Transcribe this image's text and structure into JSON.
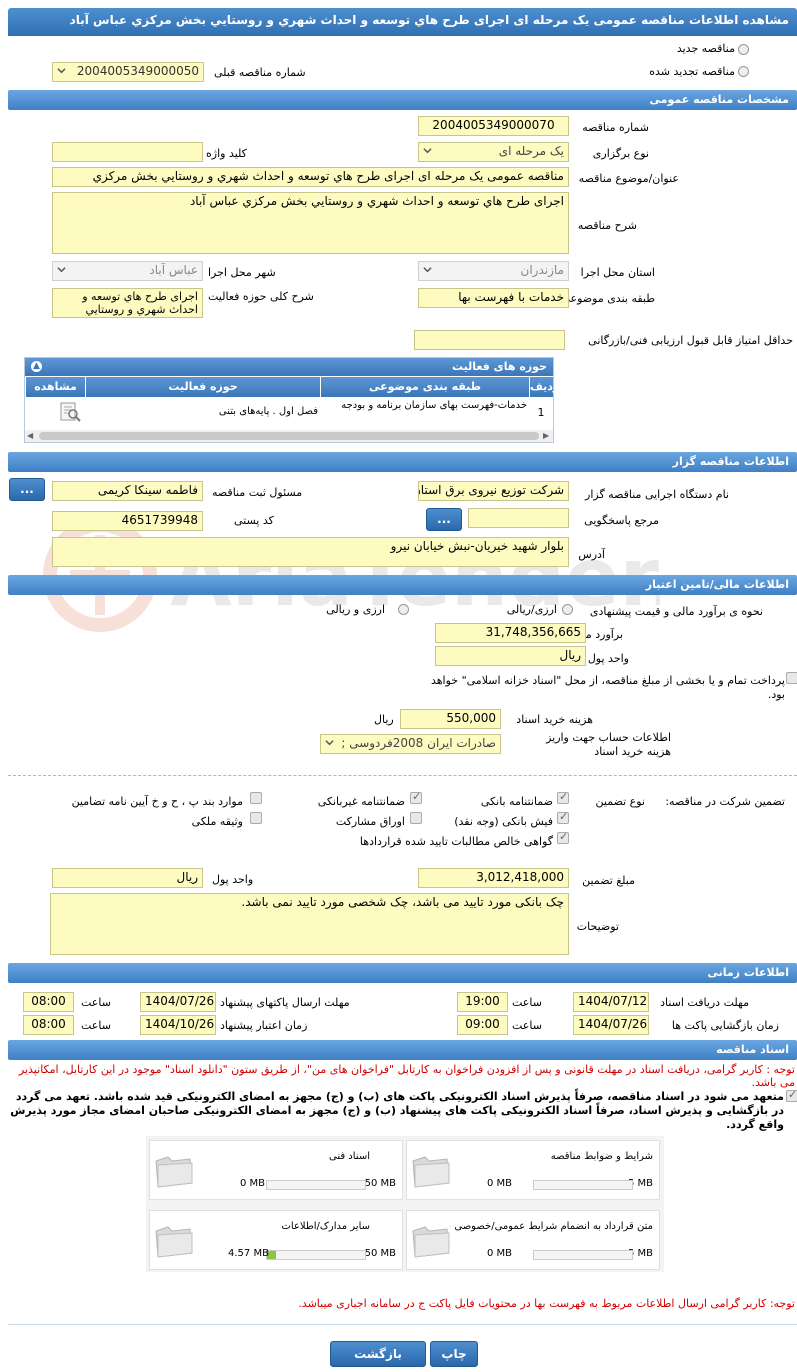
{
  "title": "مشاهده اطلاعات مناقصه عمومی یک مرحله ای اجرای طرح هاي توسعه و احداث شهري و روستايي بخش مرکزي عباس آباد",
  "top": {
    "radio_new": "مناقصه جدید",
    "radio_renewed": "مناقصه تجدید شده",
    "prev_number_label": "شماره مناقصه قبلی",
    "prev_number_value": "2004005349000050"
  },
  "sections": {
    "general": "مشخصات مناقصه عمومی",
    "organizer": "اطلاعات مناقصه گزار",
    "financial": "اطلاعات مالی/تامین اعتبار",
    "timing": "اطلاعات زمانی",
    "documents": "اسناد مناقصه"
  },
  "general": {
    "number_label": "شماره مناقصه",
    "number_value": "2004005349000070",
    "type_label": "نوع برگزاری",
    "type_value": "یک مرحله ای",
    "keyword_label": "کلید واژه",
    "keyword_value": "",
    "subject_label": "عنوان/موضوع مناقصه",
    "subject_value": "مناقصه عمومی یک مرحله ای اجرای طرح هاي توسعه و احداث شهري و روستايي بخش مرکزي",
    "desc_label": "شرح مناقصه",
    "desc_value": "اجرای طرح هاي توسعه و احداث شهري و روستايي بخش مرکزي عباس آباد",
    "province_label": "استان محل اجرا",
    "province_value": "مازندران",
    "city_label": "شهر محل اجرا",
    "city_value": "عباس آباد",
    "category_label": "طبقه بندی موضوعی",
    "category_value": "خدمات با فهرست بها",
    "activity_label": "شرح کلی حوزه فعالیت",
    "activity_value": "اجرای طرح هاي توسعه و احداث شهري و روستايي",
    "min_score_label": "حداقل امتیاز قابل قبول ارزیابی فنی/بازرگانی",
    "min_score_value": ""
  },
  "activity_grid": {
    "title": "حوزه های فعالیت",
    "columns": [
      "ردیف",
      "طبقه بندی موضوعی",
      "حوزه فعالیت",
      "مشاهده"
    ],
    "rows": [
      {
        "index": "1",
        "category": "خدمات-فهرست بهای سازمان برنامه و بودجه",
        "field": "فصل اول . پایه‌های بتنی"
      }
    ]
  },
  "organizer": {
    "device_label": "نام دستگاه اجرایی مناقصه گزار",
    "device_value": "شرکت توزیع نیروی برق استان",
    "registrar_label": "مسئول ثبت مناقصه",
    "registrar_value": "فاطمه  سینکا کریمی",
    "more_button": "...",
    "reference_label": "مرجع پاسخگویی",
    "reference_value": "",
    "postal_label": "کد پستی",
    "postal_value": "4651739948",
    "address_label": "آدرس",
    "address_value": "بلوار شهید خیریان-نبش خیابان نیرو"
  },
  "financial": {
    "estimate_label": "نحوه ی برآورد مالی و قیمت پیشنهادی",
    "option_currency_rial": "ارزی/ریالی",
    "option_currency_and_rial": "ارزی و ریالی",
    "estimate_amount_label": "برآورد مالی",
    "estimate_amount_value": "31,748,356,665",
    "currency_unit_label": "واحد پول",
    "currency_unit_value": "ریال",
    "treasury_text": "پرداخت تمام و یا بخشی از مبلغ مناقصه، از محل \"اسناد خزانه اسلامی\" خواهد بود.",
    "doc_fee_label": "هزینه خرید اسناد",
    "doc_fee_value": "550,000",
    "doc_fee_unit": "ریال",
    "account_label": "اطلاعات حساب جهت واریز هزینه خرید اسناد",
    "account_value": "صادرات ایران 2008فردوسی ;"
  },
  "guarantee": {
    "label": "تضمین شرکت در مناقصه:",
    "type_label": "نوع تضمین",
    "options": {
      "bank_guarantee": "ضمانتنامه بانکی",
      "non_bank_guarantee": "ضمانتنامه غیربانکی",
      "items_bc": "موارد بند پ ، ح و خ آیین نامه تضامین",
      "bank_receipt": "فیش بانکی (وجه نقد)",
      "participation_bonds": "اوراق مشارکت",
      "property": "وثیقه ملکی",
      "net_claims": "گواهی خالص مطالبات تایید شده قراردادها"
    },
    "amount_label": "مبلغ تضمین",
    "amount_value": "3,012,418,000",
    "unit_label": "واحد پول",
    "unit_value": "ریال",
    "notes_label": "توضیحات",
    "notes_value": "چک بانکی مورد تایید می باشد، چک شخصی مورد تایید نمی باشد."
  },
  "timing": {
    "doc_receive_label": "مهلت دریافت اسناد",
    "doc_receive_date": "1404/07/12",
    "doc_receive_time": "19:00",
    "send_label": "مهلت ارسال پاکتهای پیشنهاد",
    "send_date": "1404/07/26",
    "send_time": "08:00",
    "open_label": "زمان بازگشایی پاکت ها",
    "open_date": "1404/07/26",
    "open_time": "09:00",
    "validity_label": "زمان اعتبار پیشنهاد",
    "validity_date": "1404/10/26",
    "validity_time": "08:00",
    "time_label": "ساعت"
  },
  "documents": {
    "notice1": "توجه : کاربر گرامی، دریافت اسناد در مهلت قانونی و پس از افزودن فراخوان به کارتابل \"فراخوان های من\"، از طریق ستون \"دانلود اسناد\" موجود در این کارتابل، امکانپذیر می باشد.",
    "commitment": "متعهد می شود در اسناد مناقصه، صرفاً پذیرش اسناد الکترونیکی پاکت های (ب) و (ج) مجهز به امضای الکترونیکی قید شده باشد. تعهد می گردد در بازگشایی و پذیرش اسناد، صرفاً اسناد الکترونیکی پاکت های پیشنهاد (ب) و (ج) مجهز به امضای الکترونیکی صاحبان امضای مجاز مورد پذیرش واقع گردد.",
    "files": [
      {
        "name": "شرایط و ضوابط مناقصه",
        "used": "0 MB",
        "max": "5 MB",
        "fill": 0
      },
      {
        "name": "اسناد فنی",
        "used": "0 MB",
        "max": "50 MB",
        "fill": 0
      },
      {
        "name": "متن قرارداد به انضمام شرایط عمومی/خصوصی",
        "used": "0 MB",
        "max": "5 MB",
        "fill": 0
      },
      {
        "name": "سایر مدارک/اطلاعات",
        "used": "4.57 MB",
        "max": "50 MB",
        "fill": 0.0914
      }
    ],
    "notice2": "توجه: کاربر گرامی ارسال اطلاعات مربوط به فهرست بها در محتویات فایل پاکت ج در سامانه اجباری میباشد."
  },
  "buttons": {
    "print": "چاپ",
    "back": "بازگشت"
  },
  "colors": {
    "header_blue": "#3f7fc4",
    "field_yellow": "#fdfbc0",
    "notice_red": "#d00000"
  }
}
